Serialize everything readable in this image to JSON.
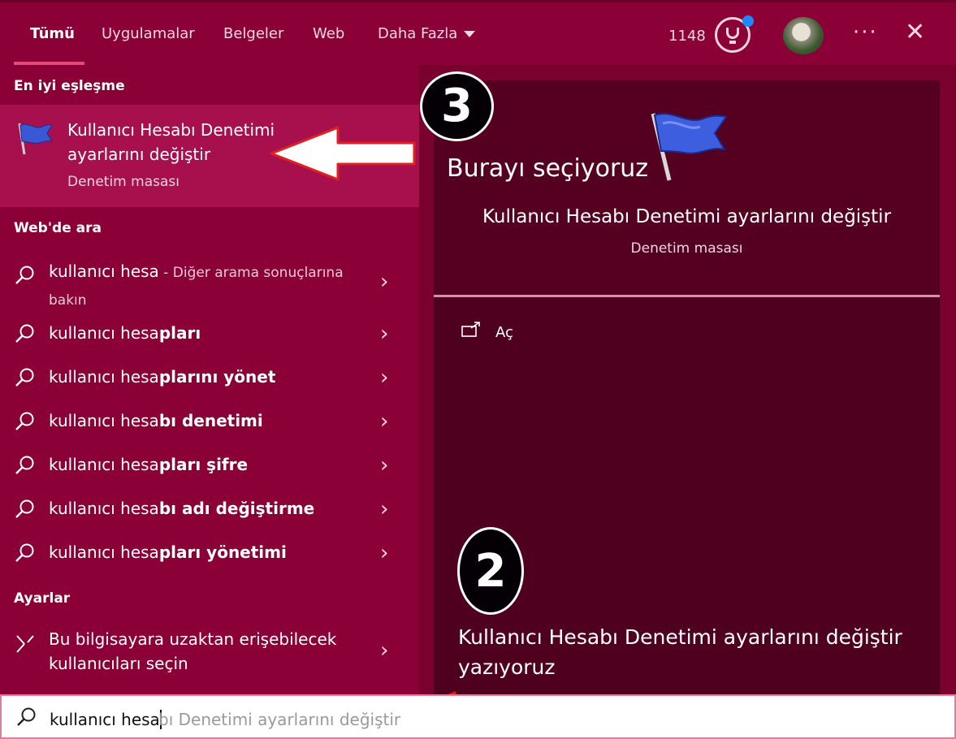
{
  "header": {
    "tabs": [
      "Tümü",
      "Uygulamalar",
      "Belgeler",
      "Web",
      "Daha Fazla"
    ],
    "points": "1148"
  },
  "left": {
    "best_match_label": "En iyi eşleşme",
    "best_match": {
      "title": "Kullanıcı Hesabı Denetimi ayarlarını değiştir",
      "subtitle": "Denetim masası"
    },
    "web_label": "Web'de ara",
    "web_first": {
      "query": "kullanıcı hesa",
      "hint": " - Diğer arama sonuçlarına bakın"
    },
    "web_items": [
      {
        "normal": "kullanıcı hesa",
        "bold": "pları"
      },
      {
        "normal": "kullanıcı hesa",
        "bold": "plarını yönet"
      },
      {
        "normal": "kullanıcı hesa",
        "bold": "bı denetimi"
      },
      {
        "normal": "kullanıcı hesa",
        "bold": "pları şifre"
      },
      {
        "normal": "kullanıcı hesa",
        "bold": "bı adı değiştirme"
      },
      {
        "normal": "kullanıcı hesa",
        "bold": "pları yönetimi"
      }
    ],
    "settings_label": "Ayarlar",
    "settings_item": "Bu bilgisayara uzaktan erişebilecek kullanıcıları seçin"
  },
  "right": {
    "title": "Kullanıcı Hesabı Denetimi ayarlarını değiştir",
    "subtitle": "Denetim masası",
    "open_label": "Aç"
  },
  "annotations": {
    "badge_top": "3",
    "badge_bottom": "2",
    "select_text": "Burayı seçiyoruz",
    "type_text": "Kullanıcı Hesabı Denetimi ayarlarını değiştir yazıyoruz"
  },
  "search": {
    "typed": "kullanıcı hesa",
    "ghost": "bı Denetimi ayarlarını değiştir"
  },
  "colors": {
    "accent": "#8b0036",
    "highlight": "#a8104d",
    "arrow": "#e02020"
  }
}
